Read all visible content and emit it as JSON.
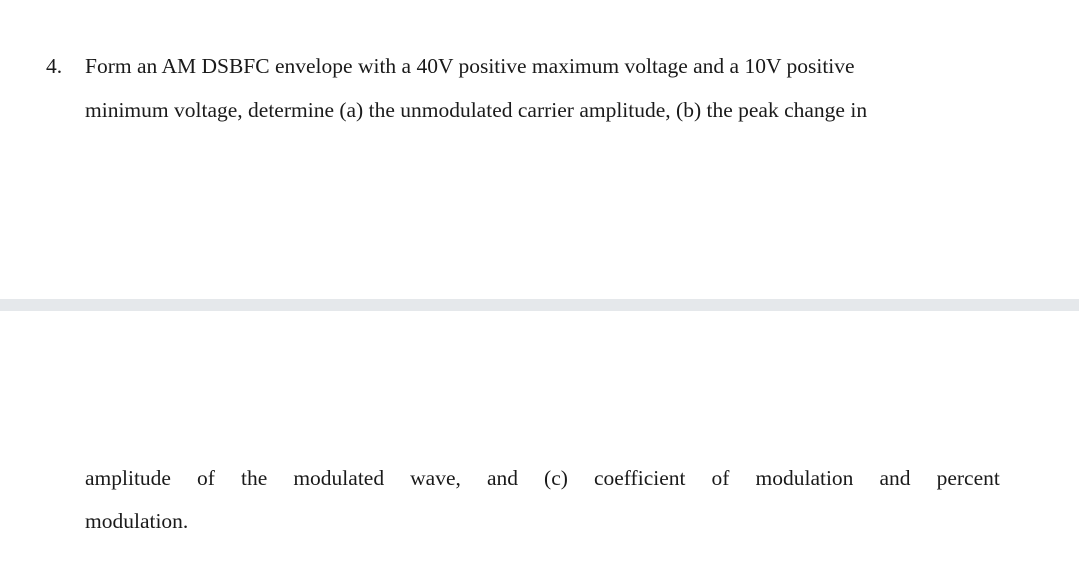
{
  "document": {
    "background_color": "#ffffff",
    "text_color": "#1a1a1a",
    "separator_color": "#e5e8eb"
  },
  "question": {
    "number": "4.",
    "line_1": "Form an AM DSBFC envelope with a 40V positive maximum voltage and a 10V positive",
    "line_2": "minimum voltage, determine (a) the unmodulated carrier amplitude, (b) the peak change in",
    "line_3_words": [
      "amplitude",
      "of",
      "the",
      "modulated",
      "wave,",
      "and",
      "(c)",
      "coefficient",
      "of",
      "modulation",
      "and",
      "percent"
    ],
    "line_4": "modulation."
  }
}
